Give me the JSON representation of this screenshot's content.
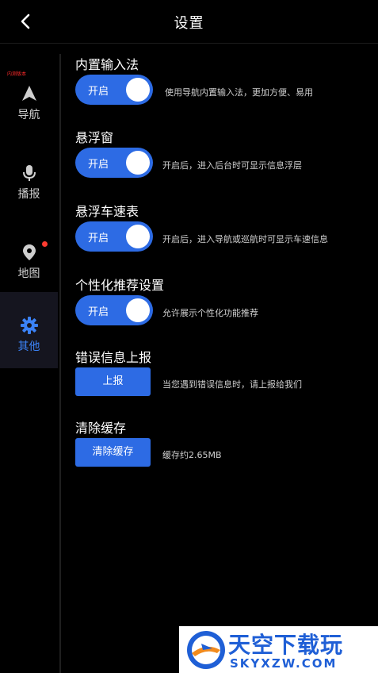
{
  "header": {
    "title": "设置",
    "back_icon": "chevron-left-icon"
  },
  "sidebar": {
    "items": [
      {
        "label": "导航",
        "icon": "navigation-arrow-icon"
      },
      {
        "label": "播报",
        "icon": "microphone-icon"
      },
      {
        "label": "地图",
        "icon": "map-pin-icon",
        "badge": "red-dot"
      },
      {
        "label": "其他",
        "icon": "gear-icon",
        "active": true
      }
    ],
    "tiny_red_text": "内测版本"
  },
  "settings": {
    "builtin_ime": {
      "title": "内置输入法",
      "toggle_label": "开启",
      "desc": "使用导航内置输入法，更加方便、易用"
    },
    "floating_window": {
      "title": "悬浮窗",
      "toggle_label": "开启",
      "desc": "开启后，进入后台时可显示信息浮层"
    },
    "speedometer": {
      "title": "悬浮车速表",
      "toggle_label": "开启",
      "desc": "开启后，进入导航或巡航时可显示车速信息"
    },
    "personalized": {
      "title": "个性化推荐设置",
      "toggle_label": "开启",
      "desc": "允许展示个性化功能推荐"
    },
    "error_report": {
      "title": "错误信息上报",
      "button_label": "上报",
      "desc": "当您遇到错误信息时，请上报给我们"
    },
    "clear_cache": {
      "title": "清除缓存",
      "button_label": "清除缓存",
      "desc": "缓存约2.65MB"
    }
  },
  "watermark": {
    "big": "天空下载玩",
    "small": "SKYXZW.COM"
  },
  "colors": {
    "accent": "#2d6be4",
    "active_nav": "#3b82f6",
    "badge": "#ff3b30",
    "background": "#000000"
  }
}
